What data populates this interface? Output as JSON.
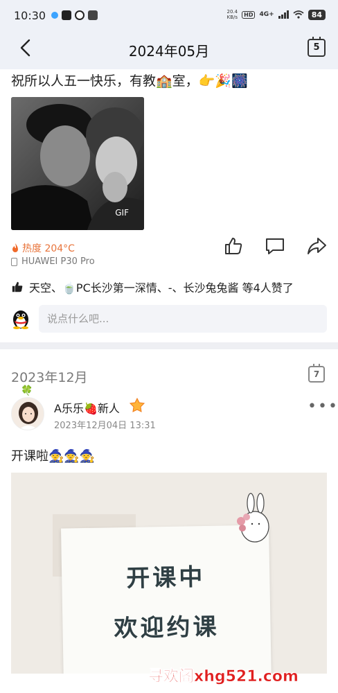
{
  "status_bar": {
    "time": "10:30",
    "net_speed_value": "20.4",
    "net_speed_unit": "KB/s",
    "hd": "HD",
    "signal": "4G+",
    "battery": "84"
  },
  "header": {
    "title": "2024年05月",
    "calendar_day": "5"
  },
  "post1": {
    "text": "祝所以人五一快乐，有教🏫室，👉🎉🎆",
    "gif_label": "GIF",
    "heat": "热度 204°C",
    "device": "HUAWEI P30 Pro",
    "likes": "天空、🍵PC长沙第一深情、-、长沙兔兔酱 等4人赞了",
    "comment_placeholder": "说点什么吧..."
  },
  "section2": {
    "month": "2023年12月",
    "calendar_day": "7"
  },
  "post2": {
    "user_name": "A乐乐🍓新人",
    "date": "2023年12月04日 13:31",
    "text": "开课啦🧙🧙🧙",
    "poster_line1": "开课中",
    "poster_line2": "欢迎约课"
  },
  "watermark": "寻欢阁xhg521.com",
  "colors": {
    "header_bg": "#eef1f7",
    "heat": "#e8743b",
    "divider": "#eeeff3",
    "watermark": "#e01f1f"
  }
}
